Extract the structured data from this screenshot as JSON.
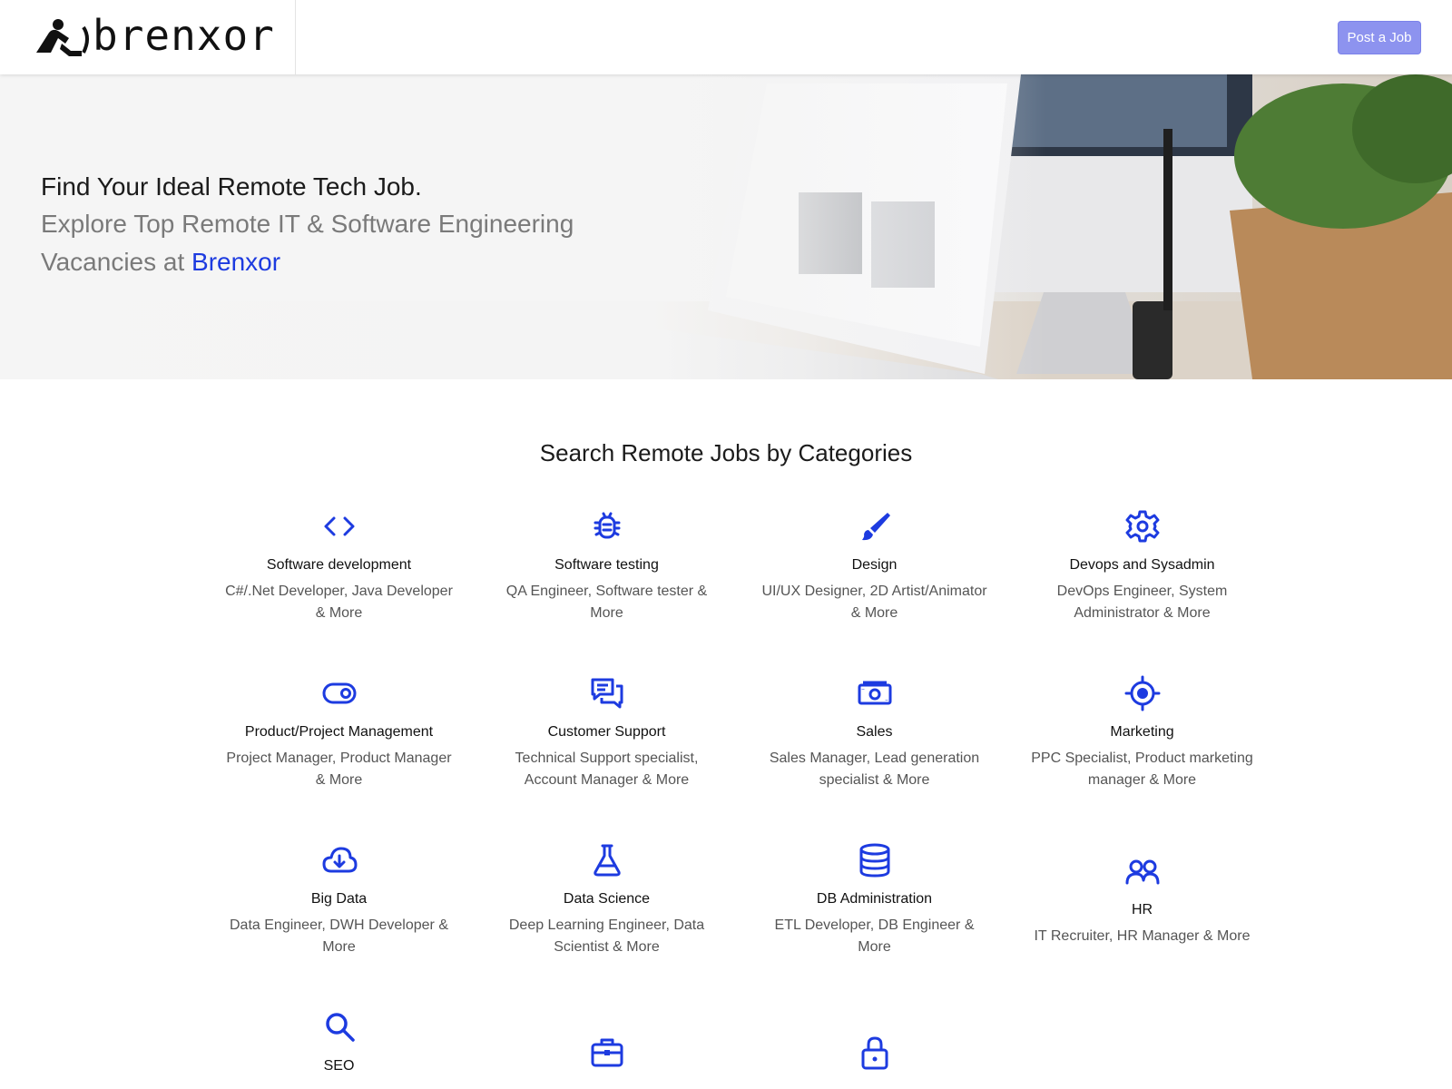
{
  "header": {
    "logo_text": "brenxor",
    "post_job_label": "Post a Job"
  },
  "hero": {
    "title": "Find Your Ideal Remote Tech Job.",
    "subtitle": "Explore Top Remote IT & Software Engineering Vacancies at",
    "brand": "Brenxor"
  },
  "categories": {
    "heading": "Search Remote Jobs by Categories",
    "accent_color": "#1d3be0",
    "items": [
      {
        "icon": "code-icon",
        "name": "Software development",
        "desc": "C#/.Net Developer, Java Developer & More"
      },
      {
        "icon": "bug-icon",
        "name": "Software testing",
        "desc": "QA Engineer, Software tester & More"
      },
      {
        "icon": "brush-icon",
        "name": "Design",
        "desc": "UI/UX Designer, 2D Artist/Animator & More"
      },
      {
        "icon": "gear-icon",
        "name": "Devops and Sysadmin",
        "desc": "DevOps Engineer, System Administrator & More"
      },
      {
        "icon": "toggle-icon",
        "name": "Product/Project Management",
        "desc": "Project Manager, Product Manager & More"
      },
      {
        "icon": "chat-icon",
        "name": "Customer Support",
        "desc": "Technical Support specialist, Account Manager & More"
      },
      {
        "icon": "cash-icon",
        "name": "Sales",
        "desc": "Sales Manager, Lead generation specialist & More"
      },
      {
        "icon": "target-icon",
        "name": "Marketing",
        "desc": "PPC Specialist, Product marketing manager & More"
      },
      {
        "icon": "cloud-download-icon",
        "name": "Big Data",
        "desc": "Data Engineer, DWH Developer & More"
      },
      {
        "icon": "flask-icon",
        "name": "Data Science",
        "desc": "Deep Learning Engineer, Data Scientist & More"
      },
      {
        "icon": "database-icon",
        "name": "DB Administration",
        "desc": "ETL Developer, DB Engineer & More"
      },
      {
        "icon": "users-icon",
        "name": "HR",
        "desc": "IT Recruiter, HR Manager & More"
      },
      {
        "icon": "search-icon",
        "name": "SEO",
        "desc": ""
      },
      {
        "icon": "briefcase-icon",
        "name": "",
        "desc": ""
      },
      {
        "icon": "lock-icon",
        "name": "",
        "desc": ""
      }
    ]
  }
}
